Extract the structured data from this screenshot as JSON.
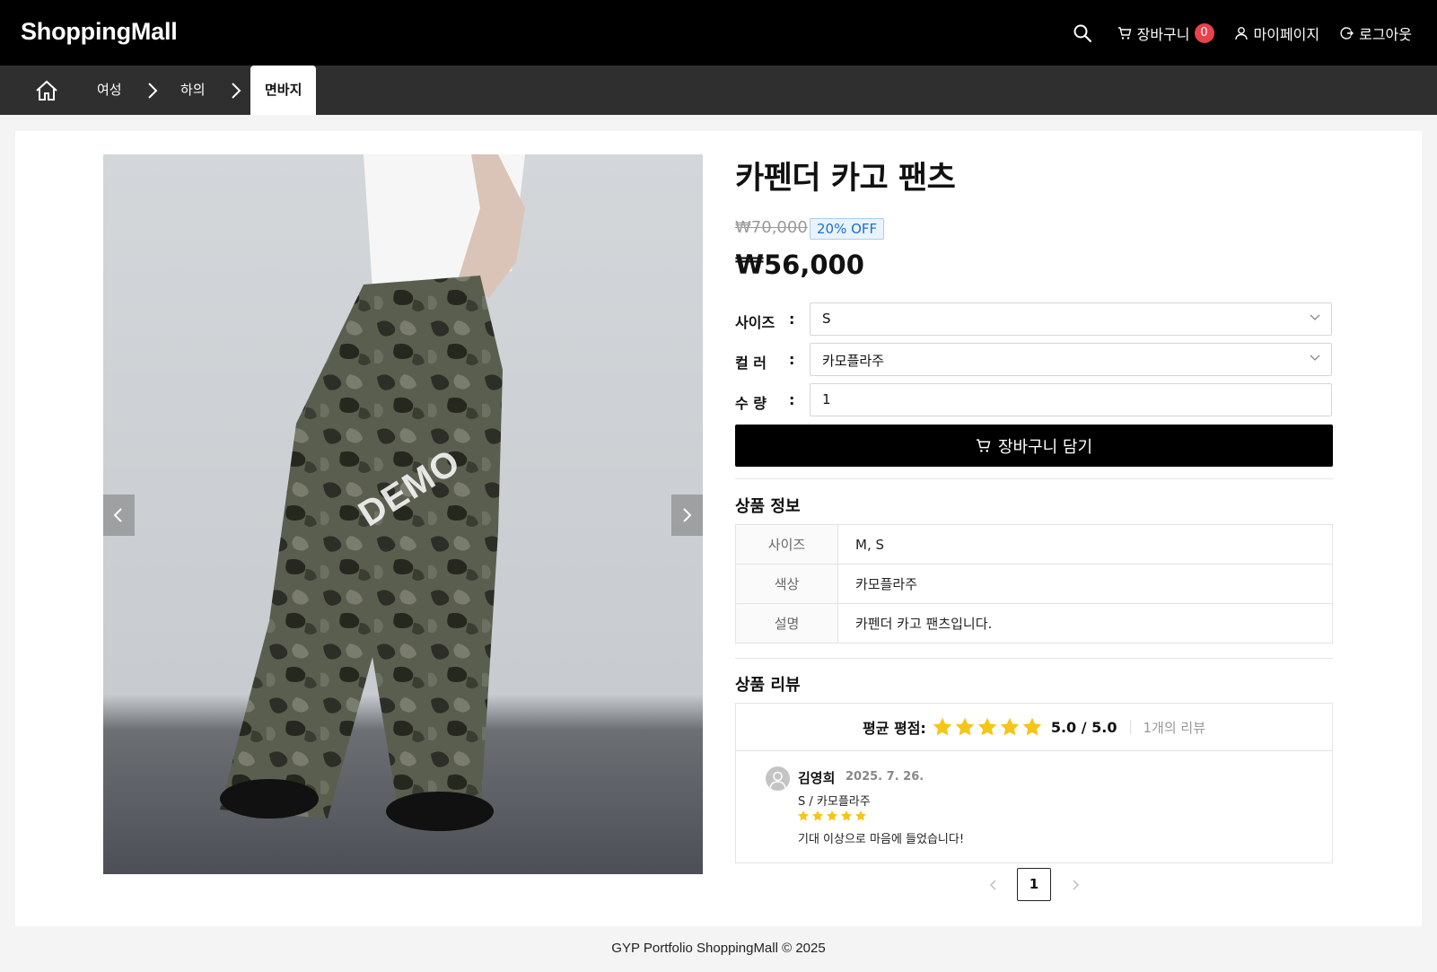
{
  "header": {
    "logo": "ShoppingMall",
    "cart_label": "장바구니",
    "cart_count": "0",
    "mypage_label": "마이페이지",
    "logout_label": "로그아웃"
  },
  "breadcrumb": {
    "items": [
      "여성",
      "하의",
      "면바지"
    ]
  },
  "product": {
    "image_watermark": "DEMO",
    "title": "카펜더 카고 팬츠",
    "original_price": "₩70,000",
    "discount_badge": "20% OFF",
    "price": "₩56,000",
    "size_label": "사이즈",
    "color_label": "컬 러",
    "qty_label": "수 량",
    "colon": ":",
    "size_value": "S",
    "color_value": "카모플라주",
    "qty_value": "1",
    "add_to_cart_label": "장바구니 담기"
  },
  "info": {
    "section_title": "상품 정보",
    "rows": [
      {
        "key": "사이즈",
        "value": "M, S"
      },
      {
        "key": "색상",
        "value": "카모플라주"
      },
      {
        "key": "설명",
        "value": "카펜더 카고 팬츠입니다."
      }
    ]
  },
  "reviews": {
    "section_title": "상품 리뷰",
    "avg_label": "평균 평점:",
    "avg_rating": 5,
    "score_text": "5.0 / 5.0",
    "count_text": "1개의 리뷰",
    "items": [
      {
        "name": "김영희",
        "date": "2025. 7. 26.",
        "option": "S / 카모플라주",
        "rating": 5,
        "text": "기대 이상으로 마음에 들었습니다!"
      }
    ]
  },
  "pagination": {
    "current": "1"
  },
  "footer": {
    "text": "GYP Portfolio ShoppingMall © 2025"
  },
  "colors": {
    "header_bg": "#000000",
    "breadcrumb_bg": "#2f2f2f",
    "badge": "#e8424a",
    "star": "#f5c518",
    "discount": "#1d6fc8"
  },
  "icons": [
    "search-icon",
    "cart-icon",
    "user-icon",
    "logout-icon",
    "home-icon",
    "chevron-right-icon",
    "chevron-left-icon",
    "chevron-down-icon",
    "star-icon",
    "avatar-icon"
  ]
}
